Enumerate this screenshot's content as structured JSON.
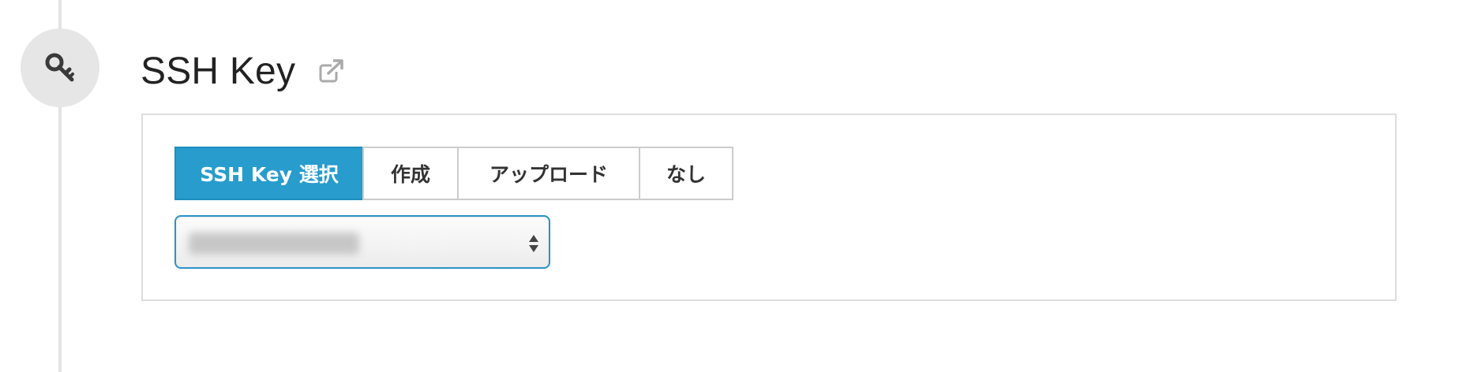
{
  "section": {
    "title": "SSH Key",
    "icon": "key-icon",
    "external_link_icon": "external-link-icon"
  },
  "tabs": [
    {
      "label": "SSH Key 選択",
      "active": true
    },
    {
      "label": "作成",
      "active": false
    },
    {
      "label": "アップロード",
      "active": false
    },
    {
      "label": "なし",
      "active": false
    }
  ],
  "key_select": {
    "selected_value": "",
    "value_obscured": true
  },
  "colors": {
    "accent": "#279ccd",
    "timeline": "#e3e3e3",
    "step_circle": "#e6e6e6",
    "panel_border": "#dddddd"
  }
}
